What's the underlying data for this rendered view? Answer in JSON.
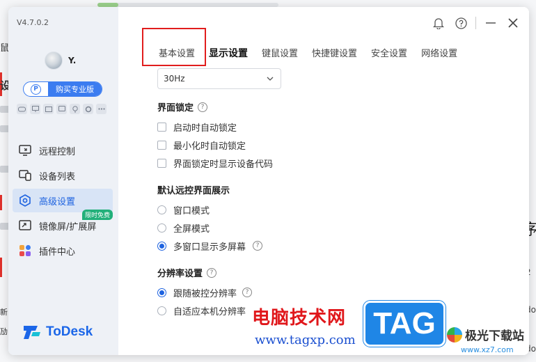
{
  "background": {
    "right_chars": [
      "序",
      "2",
      "do",
      "do"
    ],
    "left_chars": [
      "鼠",
      "设",
      "新",
      "劢"
    ]
  },
  "sidebar": {
    "version": "V4.7.0.2",
    "username": "Y.",
    "pro_button": "购买专业版",
    "pro_icon": "P",
    "mini_icons": [
      "gamepad-icon",
      "monitor-icon",
      "card-icon",
      "screen-icon",
      "bulb-icon",
      "gear-icon",
      "more-icon"
    ],
    "items": [
      {
        "label": "远程控制",
        "icon": "remote-control-icon",
        "active": false
      },
      {
        "label": "设备列表",
        "icon": "device-list-icon",
        "active": false
      },
      {
        "label": "高级设置",
        "icon": "advanced-settings-icon",
        "active": true
      },
      {
        "label": "镜像屏/扩展屏",
        "icon": "mirror-screen-icon",
        "active": false,
        "badge": "限时免费"
      },
      {
        "label": "插件中心",
        "icon": "plugin-center-icon",
        "active": false
      }
    ],
    "brand": "ToDesk"
  },
  "tabs": [
    "基本设置",
    "显示设置",
    "键鼠设置",
    "快捷键设置",
    "安全设置",
    "网络设置"
  ],
  "content": {
    "fps_select": "30Hz",
    "lock": {
      "title": "界面锁定",
      "options": [
        "启动时自动锁定",
        "最小化时自动锁定",
        "界面锁定时显示设备代码"
      ]
    },
    "default_view": {
      "title": "默认远控界面展示",
      "options": [
        "窗口模式",
        "全屏模式",
        "多窗口显示多屏幕"
      ],
      "selected": 2
    },
    "resolution": {
      "title": "分辨率设置",
      "options": [
        "跟随被控分辨率",
        "自适应本机分辨率"
      ],
      "selected": 0
    }
  },
  "watermark": {
    "title": "电脑技术网",
    "url": "www.tagxp.com",
    "tag": "TAG",
    "site": "极光下载站",
    "site_url": "www.xz7.com"
  },
  "colors": {
    "accent": "#1e63e0",
    "highlight_box": "#e11d1d",
    "sidebar_bg": "#eef1f6"
  }
}
